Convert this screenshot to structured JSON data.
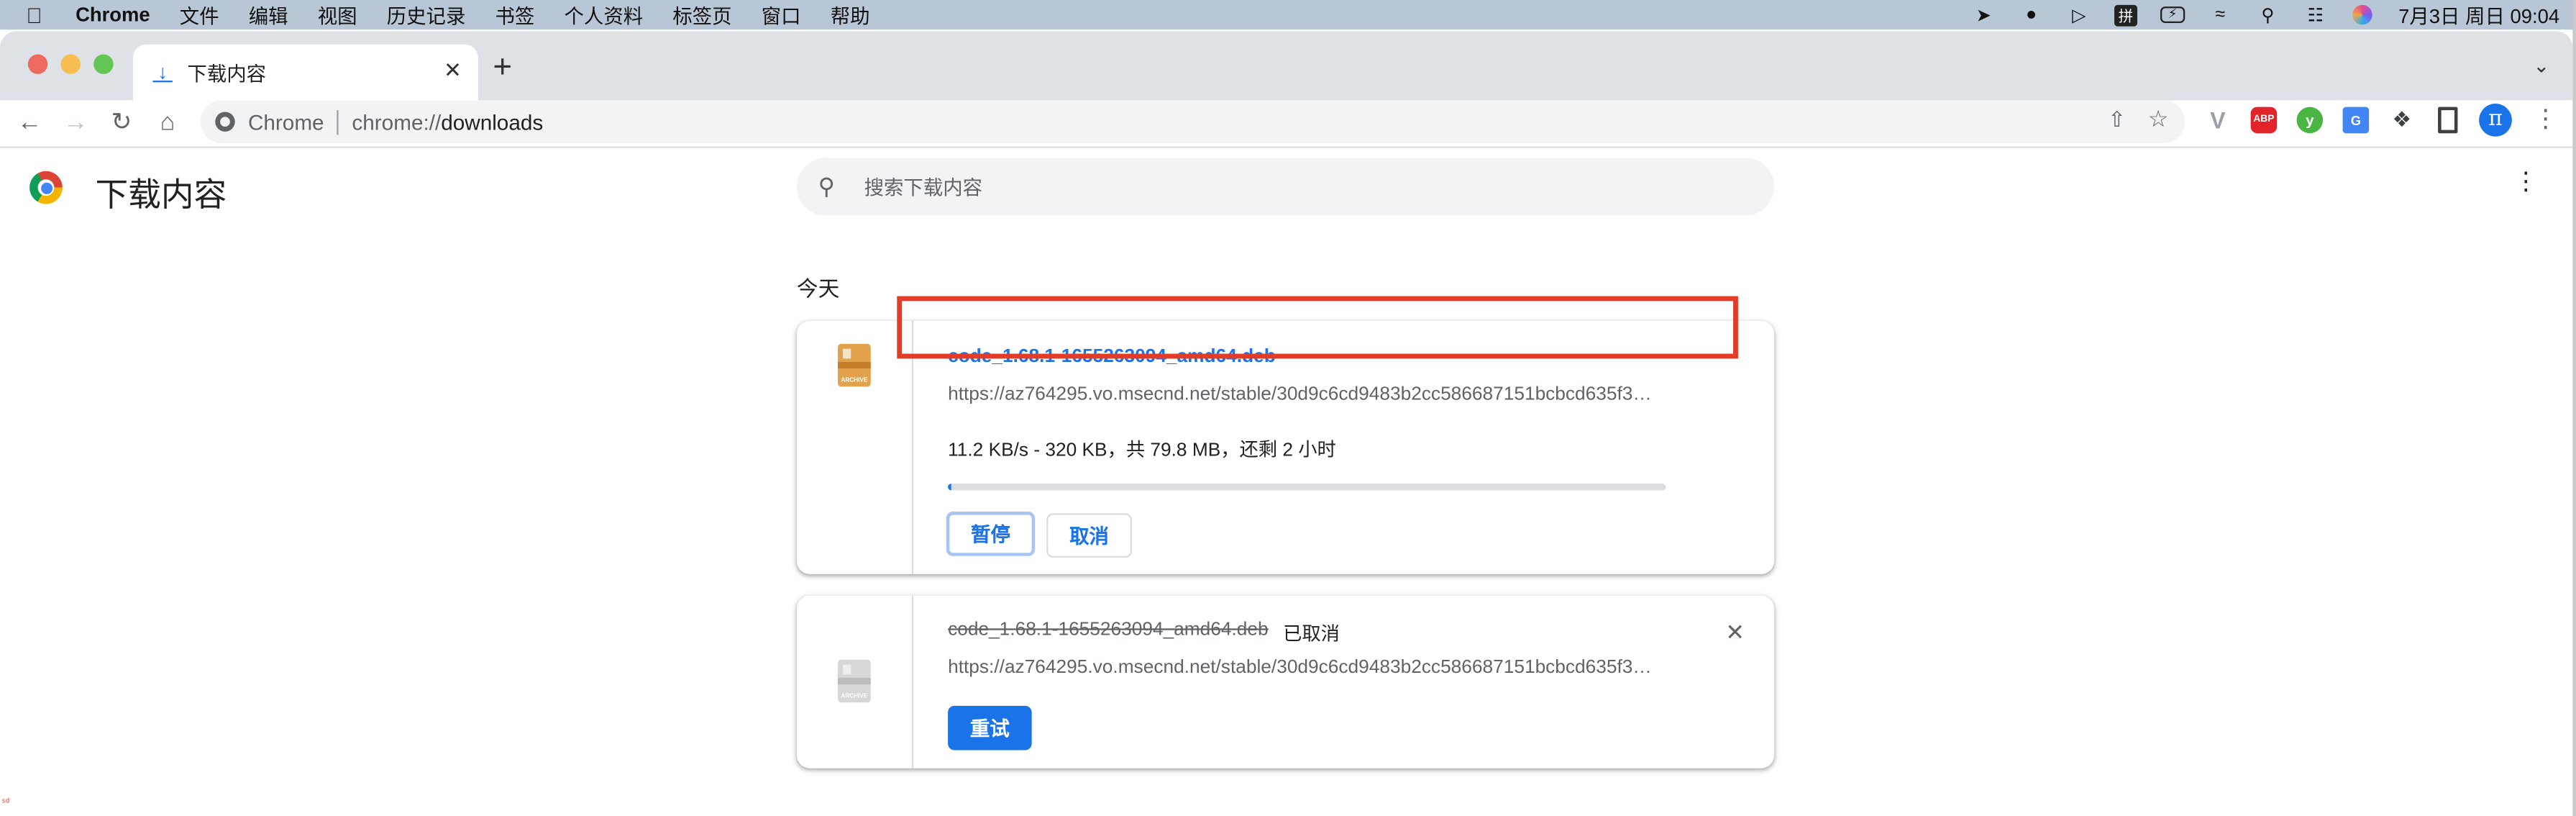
{
  "menubar": {
    "apple_icon": "apple-logo",
    "app_name": "Chrome",
    "items": [
      "文件",
      "编辑",
      "视图",
      "历史记录",
      "书签",
      "个人资料",
      "标签页",
      "窗口",
      "帮助"
    ],
    "status_icons": [
      "paper-plane-icon",
      "wechat-icon",
      "play-circle-icon",
      "pinyin-input-icon",
      "battery-charging-icon",
      "wifi-icon",
      "spotlight-search-icon",
      "control-center-icon",
      "siri-icon"
    ],
    "input_method_label": "拼",
    "clock": "7月3日 周日 09:04"
  },
  "browser": {
    "tab": {
      "title": "下载内容",
      "icon": "download-icon"
    },
    "new_tab_label": "+",
    "omnibox": {
      "site_label": "Chrome",
      "url_prefix": "chrome://",
      "url_path": "downloads"
    },
    "extensions": [
      {
        "name": "vue-devtools",
        "label": "V"
      },
      {
        "name": "adblock-plus",
        "label": "ABP"
      },
      {
        "name": "y-extension",
        "label": "y"
      },
      {
        "name": "google-translate",
        "label": "G"
      },
      {
        "name": "extensions-puzzle",
        "label": ""
      },
      {
        "name": "side-panel",
        "label": ""
      }
    ],
    "profile_initial": "π"
  },
  "page": {
    "title": "下载内容",
    "search_placeholder": "搜索下载内容",
    "date_group": "今天",
    "downloads": [
      {
        "filename": "code_1.68.1-1655263094_amd64.deb",
        "url": "https://az764295.vo.msecnd.net/stable/30d9c6cd9483b2cc586687151bcbcd635f3…",
        "status_text": "11.2 KB/s - 320 KB，共 79.8 MB，还剩 2 小时",
        "progress_percent": 0.4,
        "icon_label": "ARCHIVE",
        "buttons": {
          "pause": "暂停",
          "cancel": "取消"
        }
      },
      {
        "filename": "code_1.68.1-1655263094_amd64.deb",
        "state_label": "已取消",
        "url": "https://az764295.vo.msecnd.net/stable/30d9c6cd9483b2cc586687151bcbcd635f3…",
        "icon_label": "ARCHIVE",
        "buttons": {
          "retry": "重试"
        },
        "remove_label": "✕"
      }
    ]
  },
  "annotation": {
    "corner_text": "sd",
    "highlight_color": "#e23c27"
  },
  "colors": {
    "accent": "#1a73e8",
    "menubar": "#b9c6d6",
    "tabstrip": "#dee1e6"
  }
}
